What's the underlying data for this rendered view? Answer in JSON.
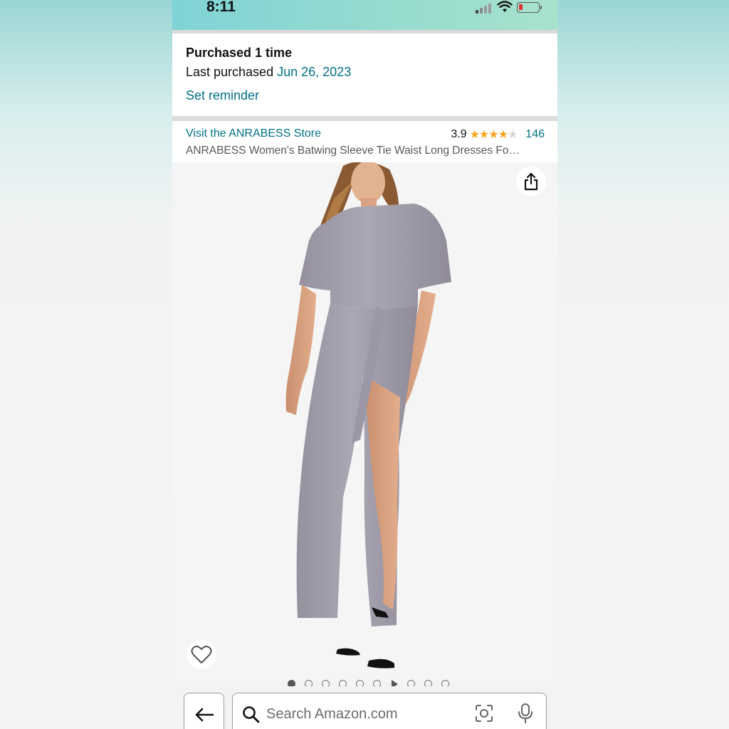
{
  "status_bar": {
    "time": "8:11"
  },
  "purchase_info": {
    "count_text": "Purchased 1 time",
    "last_purchased_label": "Last purchased",
    "last_purchased_date": "Jun 26, 2023",
    "set_reminder": "Set reminder"
  },
  "product": {
    "store_link": "Visit the ANRABESS Store",
    "rating": "3.9",
    "stars_filled": 4,
    "stars_total": 5,
    "review_count": "146",
    "title": "ANRABESS Women's Batwing Sleeve Tie Waist Long Dresses Fo…",
    "dress_color": "#a39fab"
  },
  "carousel": {
    "dots": [
      "active",
      "dot",
      "dot",
      "dot",
      "dot",
      "dot",
      "video",
      "dot",
      "dot",
      "dot"
    ]
  },
  "bottom_bar": {
    "search_placeholder": "Search Amazon.com"
  },
  "icons": {
    "share": "share-icon",
    "wishlist": "heart-icon",
    "back": "arrow-left-icon",
    "search": "search-icon",
    "lens": "camera-lens-icon",
    "mic": "microphone-icon"
  },
  "colors": {
    "link": "#007185",
    "star": "#f7a41d",
    "status_bar": "#8fd8d3"
  }
}
